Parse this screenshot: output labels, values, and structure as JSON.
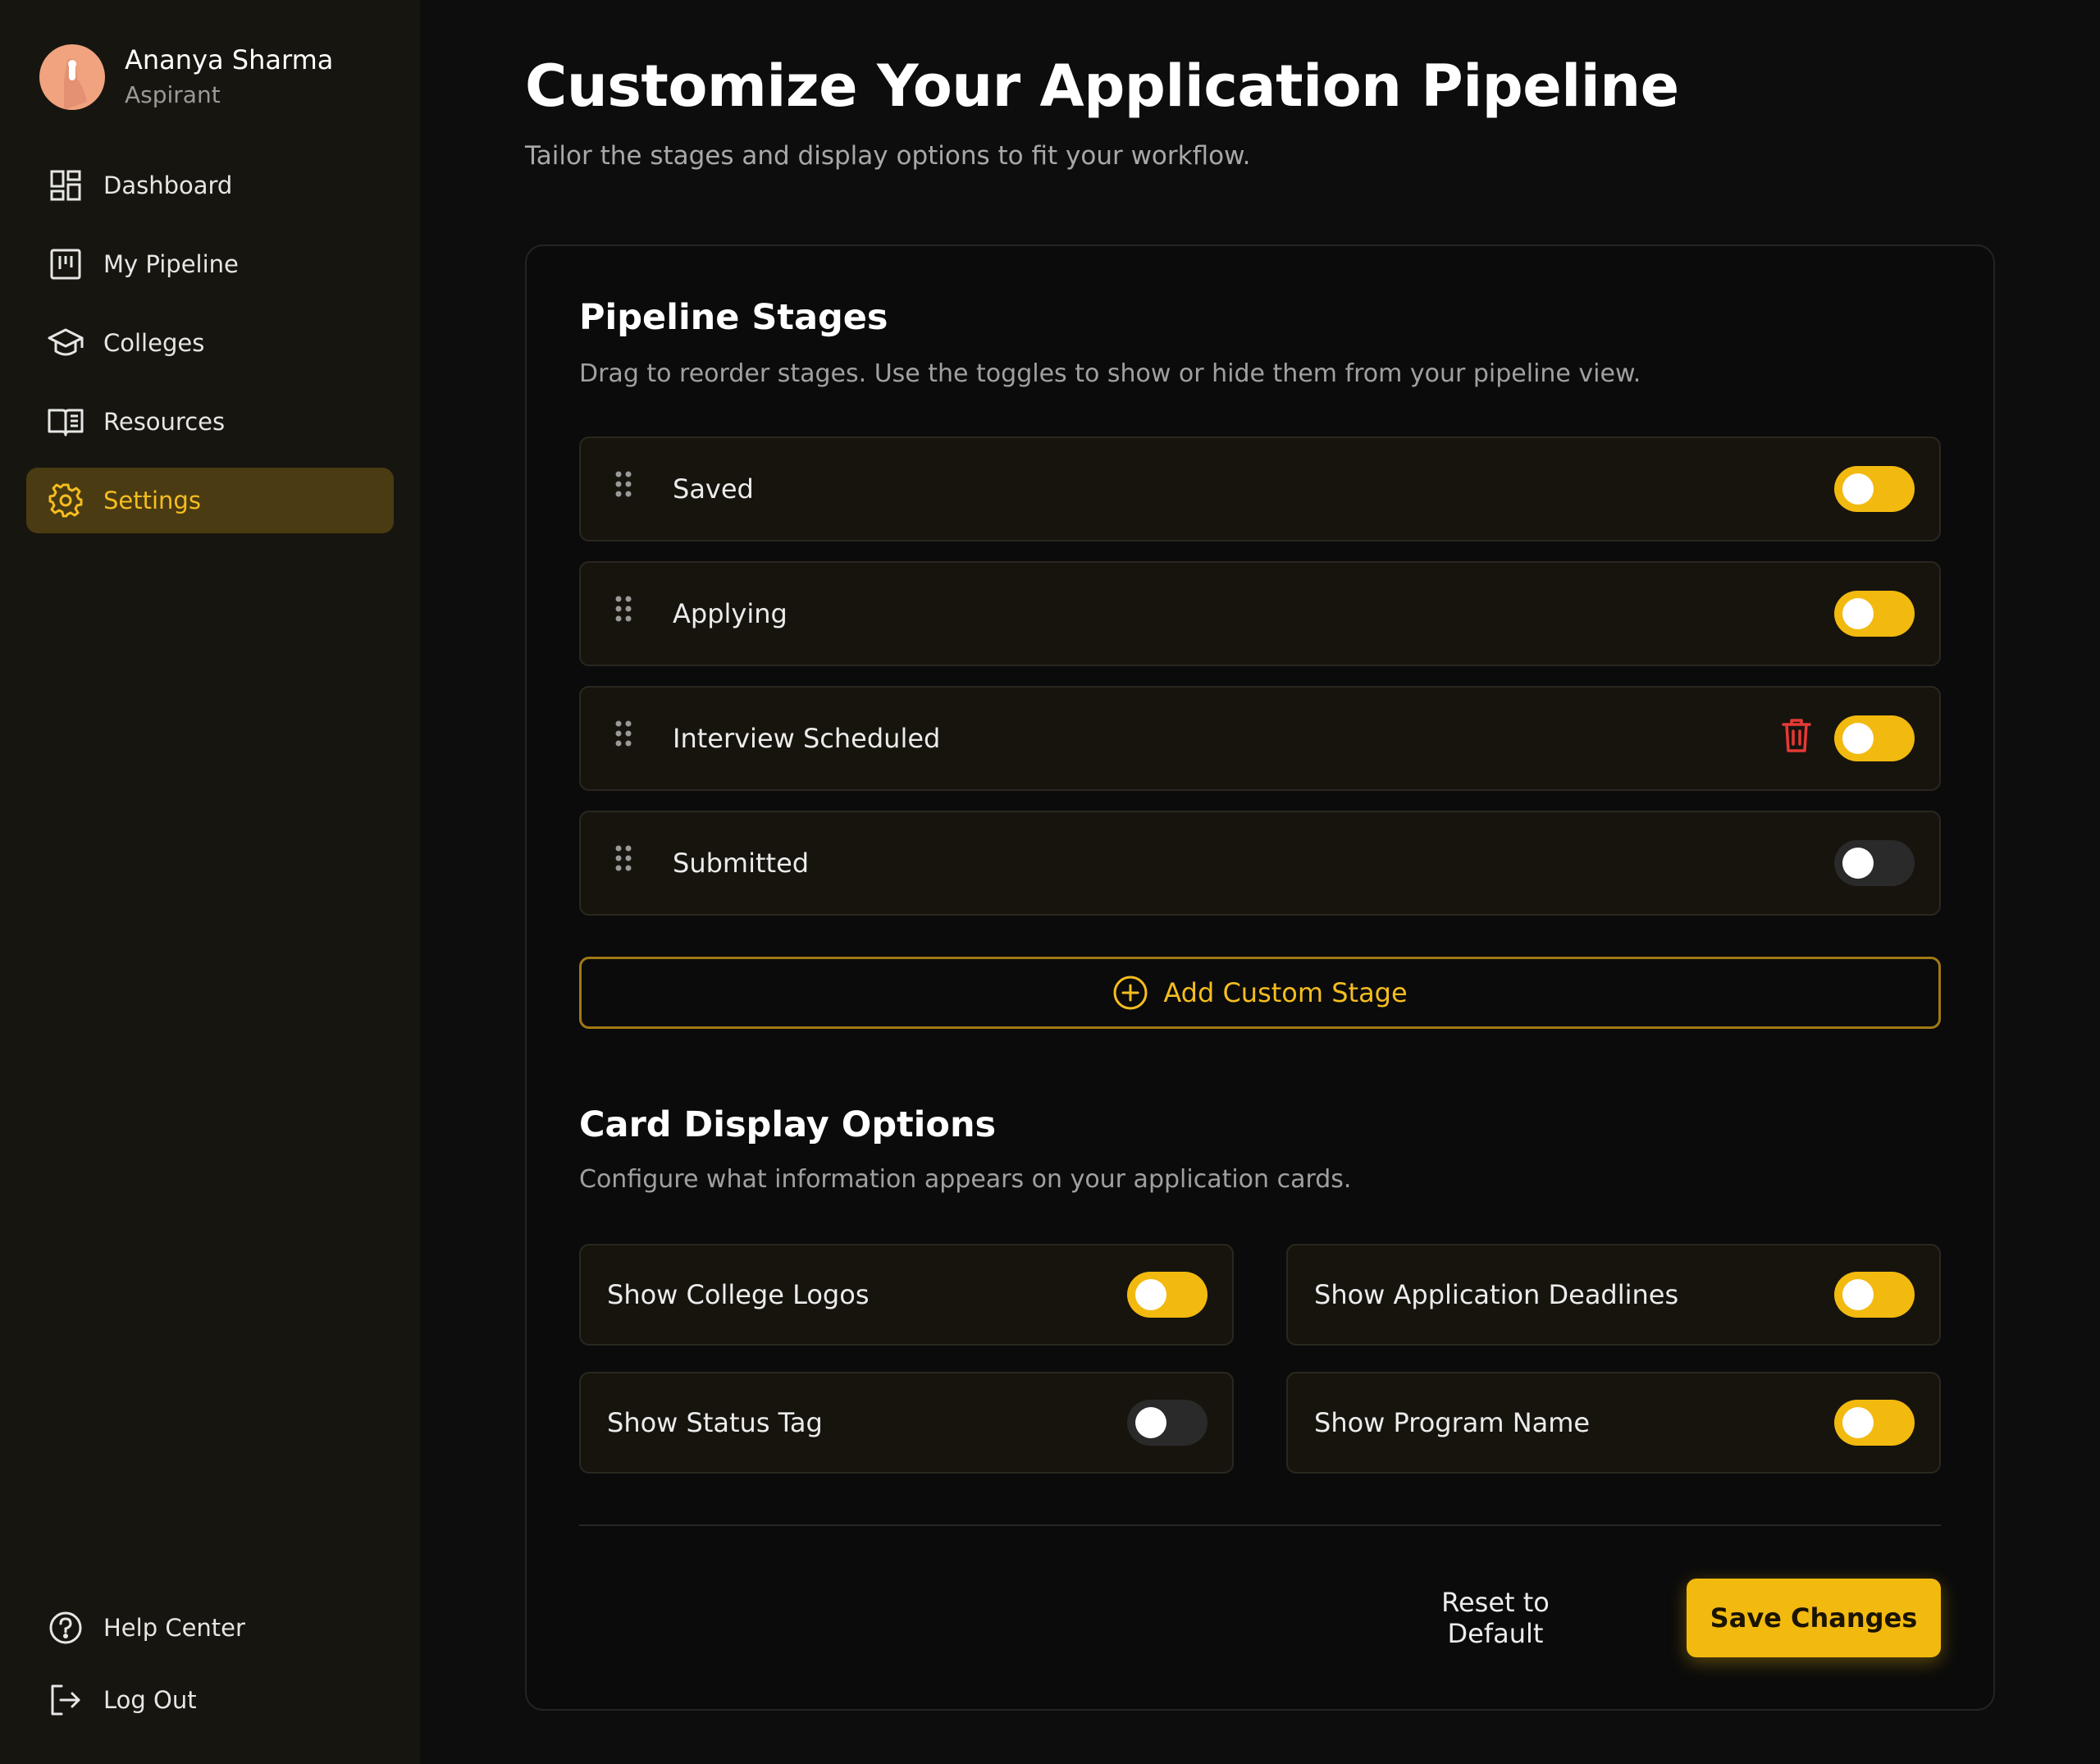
{
  "colors": {
    "accent": "#f2b90f",
    "sidebar_bg": "#17150f",
    "page_bg": "#0d0d0d",
    "delete": "#e53935"
  },
  "user": {
    "name": "Ananya Sharma",
    "role": "Aspirant"
  },
  "sidebar": {
    "items": [
      {
        "label": "Dashboard",
        "icon": "dashboard-icon",
        "active": false
      },
      {
        "label": "My Pipeline",
        "icon": "kanban-icon",
        "active": false
      },
      {
        "label": "Colleges",
        "icon": "graduation-cap-icon",
        "active": false
      },
      {
        "label": "Resources",
        "icon": "book-icon",
        "active": false
      },
      {
        "label": "Settings",
        "icon": "gear-icon",
        "active": true
      }
    ],
    "bottom_items": [
      {
        "label": "Help Center",
        "icon": "help-circle-icon"
      },
      {
        "label": "Log Out",
        "icon": "logout-icon"
      }
    ]
  },
  "header": {
    "title": "Customize Your Application Pipeline",
    "subtitle": "Tailor the stages and display options to fit your workflow."
  },
  "pipeline": {
    "title": "Pipeline Stages",
    "description": "Drag to reorder stages. Use the toggles to show or hide them from your pipeline view.",
    "stages": [
      {
        "label": "Saved",
        "enabled": true,
        "deletable": false
      },
      {
        "label": "Applying",
        "enabled": true,
        "deletable": false
      },
      {
        "label": "Interview Scheduled",
        "enabled": true,
        "deletable": true
      },
      {
        "label": "Submitted",
        "enabled": false,
        "deletable": false
      }
    ],
    "add_label": "Add Custom Stage"
  },
  "display": {
    "title": "Card Display Options",
    "description": "Configure what information appears on your application cards.",
    "options": [
      {
        "label": "Show College Logos",
        "enabled": true
      },
      {
        "label": "Show Application Deadlines",
        "enabled": true
      },
      {
        "label": "Show Status Tag",
        "enabled": false
      },
      {
        "label": "Show Program Name",
        "enabled": true
      }
    ]
  },
  "actions": {
    "reset_label": "Reset to Default",
    "save_label": "Save Changes"
  }
}
